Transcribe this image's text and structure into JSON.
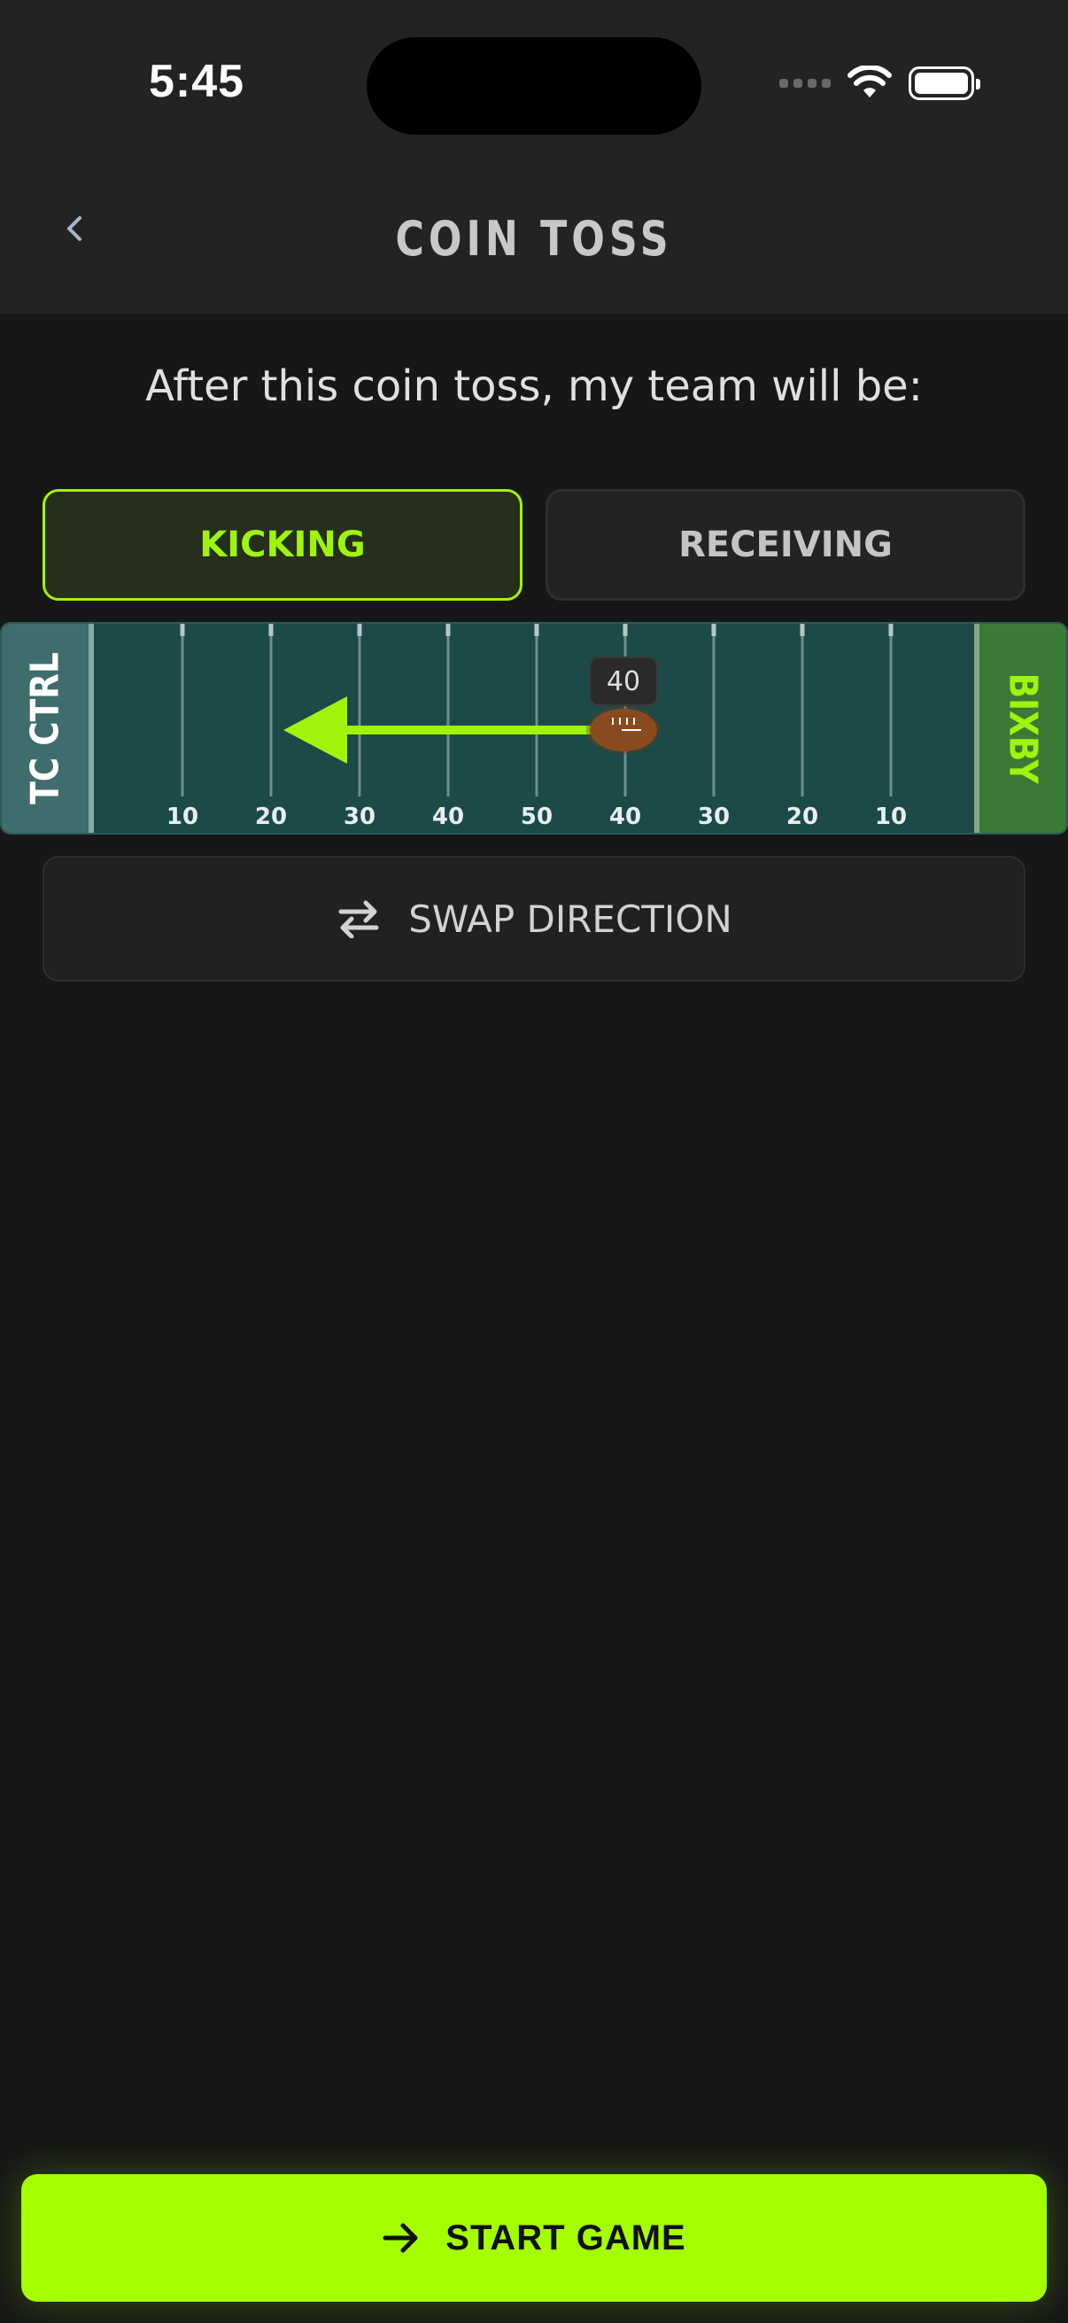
{
  "status_bar": {
    "time": "5:45"
  },
  "header": {
    "title": "COIN TOSS"
  },
  "prompt": "After this coin toss, my team will be:",
  "role_toggle": {
    "options": [
      "KICKING",
      "RECEIVING"
    ],
    "selected": "KICKING"
  },
  "field": {
    "left_team": "TC CTRL",
    "right_team": "BIXBY",
    "yard_labels": [
      "10",
      "20",
      "30",
      "40",
      "50",
      "40",
      "30",
      "20",
      "10"
    ],
    "ball_yard_line_label": "40",
    "kick_direction": "left",
    "colors": {
      "field": "#1b4a49",
      "arrow": "#9ef50a",
      "ball": "#8a4a1f",
      "accent": "#a4ff00"
    }
  },
  "swap_button": {
    "label": "SWAP DIRECTION",
    "icon": "swap-arrows-icon"
  },
  "start_button": {
    "label": "START GAME",
    "icon": "arrow-right-icon"
  }
}
